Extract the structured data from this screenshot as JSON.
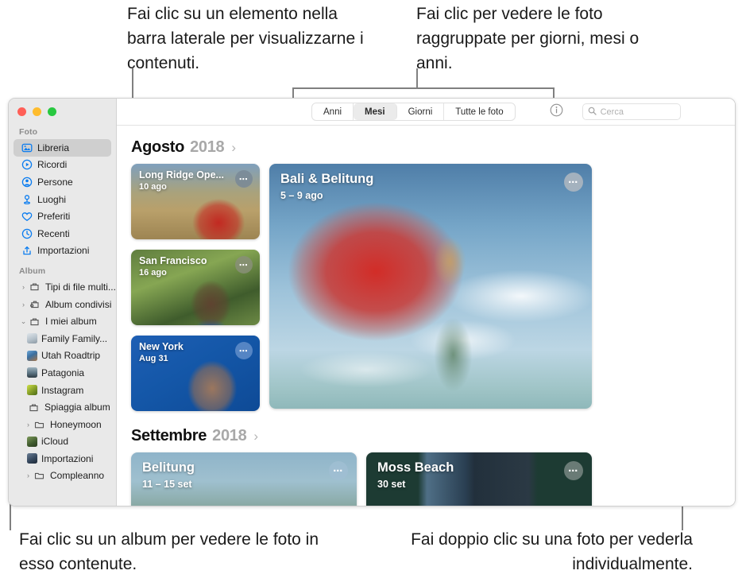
{
  "callouts": {
    "top_left": "Fai clic su un elemento nella barra laterale per visualizzarne i contenuti.",
    "top_right": "Fai clic per vedere le foto raggruppate per giorni, mesi o anni.",
    "bottom_left": "Fai clic su un album per vedere le foto in esso contenute.",
    "bottom_right": "Fai doppio clic su una foto per vederla individualmente."
  },
  "window": {
    "traffic_lights": [
      "close-button",
      "minimize-button",
      "zoom-button"
    ]
  },
  "sidebar": {
    "sections": [
      {
        "title": "Foto",
        "items": [
          {
            "label": "Libreria",
            "icon": "photo-library-icon",
            "selected": true
          },
          {
            "label": "Ricordi",
            "icon": "memories-icon",
            "selected": false
          },
          {
            "label": "Persone",
            "icon": "people-icon",
            "selected": false
          },
          {
            "label": "Luoghi",
            "icon": "places-pin-icon",
            "selected": false
          },
          {
            "label": "Preferiti",
            "icon": "heart-icon",
            "selected": false
          },
          {
            "label": "Recenti",
            "icon": "clock-icon",
            "selected": false
          },
          {
            "label": "Importazioni",
            "icon": "import-icon",
            "selected": false
          }
        ]
      },
      {
        "title": "Album",
        "items": [
          {
            "label": "Tipi di file multi...",
            "icon": "album-box-icon",
            "twisty": "collapsed"
          },
          {
            "label": "Album condivisi",
            "icon": "shared-album-icon",
            "twisty": "collapsed"
          },
          {
            "label": "I miei album",
            "icon": "album-box-icon",
            "twisty": "expanded"
          },
          {
            "label": "Family Family...",
            "icon": "album-thumbnail",
            "indent": true,
            "thumb": "#b9c3cc"
          },
          {
            "label": "Utah Roadtrip",
            "icon": "album-thumbnail",
            "indent": true,
            "thumb": "#5b86b0"
          },
          {
            "label": "Patagonia",
            "icon": "album-thumbnail",
            "indent": true,
            "thumb": "#6d7f8a"
          },
          {
            "label": "Instagram",
            "icon": "album-thumbnail",
            "indent": true,
            "thumb": "#8aa32a"
          },
          {
            "label": "Spiaggia album",
            "icon": "album-box-icon",
            "indent": true
          },
          {
            "label": "Honeymoon",
            "icon": "folder-icon",
            "indent": true,
            "twisty": "collapsed"
          },
          {
            "label": "iCloud",
            "icon": "album-thumbnail",
            "indent": true,
            "thumb": "#4a6b3c"
          },
          {
            "label": "Importazioni",
            "icon": "album-thumbnail",
            "indent": true,
            "thumb": "#3c4f66"
          },
          {
            "label": "Compleanno",
            "icon": "folder-icon",
            "indent": true,
            "twisty": "collapsed"
          }
        ]
      }
    ]
  },
  "toolbar": {
    "segments": [
      {
        "label": "Anni",
        "active": false
      },
      {
        "label": "Mesi",
        "active": true
      },
      {
        "label": "Giorni",
        "active": false
      },
      {
        "label": "Tutte le foto",
        "active": false
      }
    ],
    "info_icon": "info-icon",
    "search": {
      "placeholder": "Cerca",
      "value": "",
      "icon": "search-icon"
    }
  },
  "main": {
    "months": [
      {
        "name": "Agosto",
        "year": "2018",
        "chevron": "›",
        "small_cards": [
          {
            "title": "Long Ridge Ope...",
            "date": "10 ago",
            "menu": "more-options-icon"
          },
          {
            "title": "San Francisco",
            "date": "16 ago",
            "menu": "more-options-icon"
          },
          {
            "title": "New York",
            "date": "Aug 31",
            "menu": "more-options-icon"
          }
        ],
        "big_card": {
          "title": "Bali & Belitung",
          "date": "5 – 9 ago",
          "menu": "more-options-icon"
        }
      },
      {
        "name": "Settembre",
        "year": "2018",
        "chevron": "›",
        "cards": [
          {
            "title": "Belitung",
            "date": "11 – 15 set",
            "menu": "more-options-icon"
          },
          {
            "title": "Moss Beach",
            "date": "30 set",
            "menu": "more-options-icon"
          }
        ]
      }
    ]
  },
  "colors": {
    "accent": "#0a7cf0",
    "sidebar_bg": "#e9e9e9",
    "selection": "#cfcfcf",
    "leader_line": "#808080"
  }
}
